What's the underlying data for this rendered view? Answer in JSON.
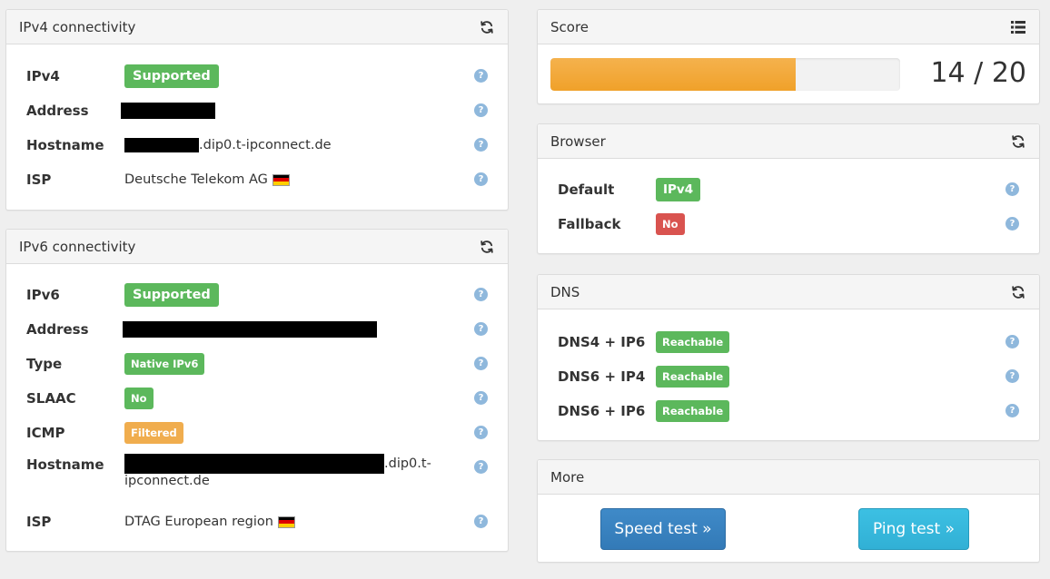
{
  "ipv4": {
    "title": "IPv4 connectivity",
    "refresh_icon": "refresh-icon",
    "rows": [
      {
        "label": "IPv4",
        "badge": "Supported"
      },
      {
        "label": "Address"
      },
      {
        "label": "Hostname",
        "suffix": ".dip0.t-ipconnect.de"
      },
      {
        "label": "ISP",
        "value": "Deutsche Telekom AG"
      }
    ]
  },
  "ipv6": {
    "title": "IPv6 connectivity",
    "refresh_icon": "refresh-icon",
    "rows": [
      {
        "label": "IPv6",
        "badge": "Supported"
      },
      {
        "label": "Address"
      },
      {
        "label": "Type",
        "badge": "Native IPv6"
      },
      {
        "label": "SLAAC",
        "badge": "No"
      },
      {
        "label": "ICMP",
        "badge": "Filtered"
      },
      {
        "label": "Hostname",
        "suffix_line1": ".dip0.t-",
        "suffix_line2": "ipconnect.de"
      },
      {
        "label": "ISP",
        "value": "DTAG European region"
      }
    ]
  },
  "score": {
    "title": "Score",
    "list_icon": "list-icon",
    "value": 14,
    "max": 20,
    "text": "14 / 20",
    "bar_color": "#f0a12a"
  },
  "browser": {
    "title": "Browser",
    "refresh_icon": "refresh-icon",
    "rows": [
      {
        "label": "Default",
        "badge": "IPv4"
      },
      {
        "label": "Fallback",
        "badge": "No"
      }
    ]
  },
  "dns": {
    "title": "DNS",
    "refresh_icon": "refresh-icon",
    "rows": [
      {
        "label": "DNS4 + IP6",
        "badge": "Reachable"
      },
      {
        "label": "DNS6 + IP4",
        "badge": "Reachable"
      },
      {
        "label": "DNS6 + IP6",
        "badge": "Reachable"
      }
    ]
  },
  "more": {
    "title": "More",
    "speed_label": "Speed test »",
    "ping_label": "Ping test »"
  },
  "help_glyph": "?",
  "colors": {
    "green": "#5cb85c",
    "red": "#d9534f",
    "orange": "#f0ad4e",
    "speed_btn": "#337ab7",
    "ping_btn": "#31b0d5"
  }
}
